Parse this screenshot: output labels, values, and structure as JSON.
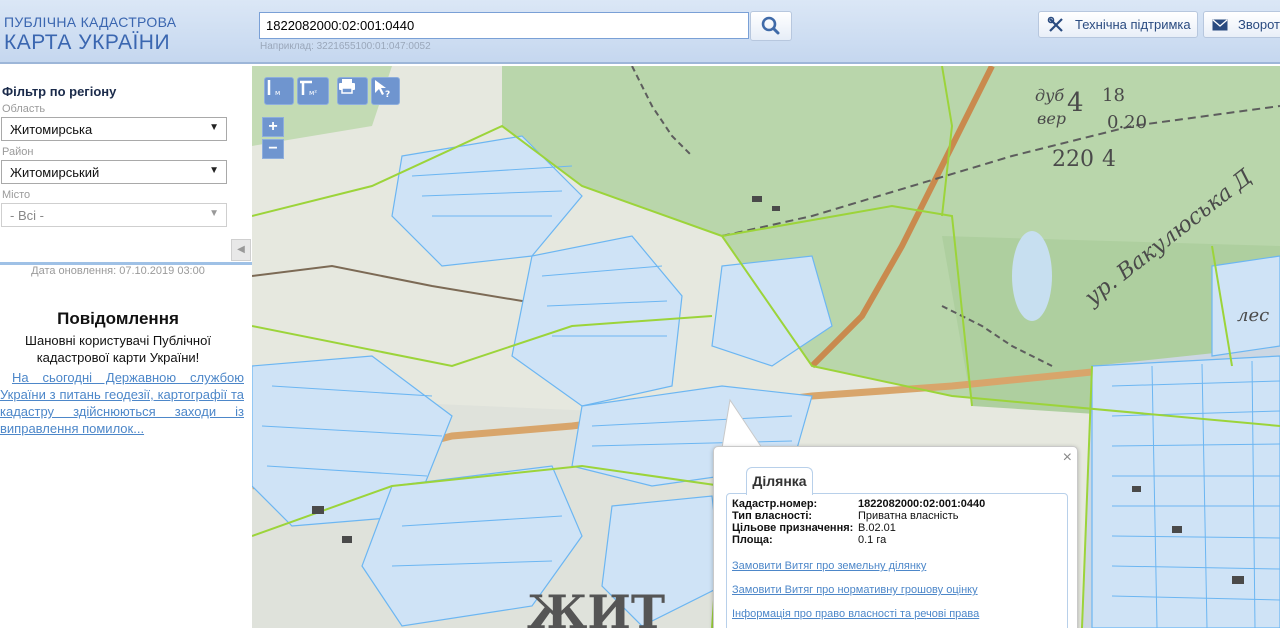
{
  "header": {
    "logo_line1": "ПУБЛІЧНА КАДАСТРОВА",
    "logo_line2": "КАРТА УКРАЇНИ",
    "search_value": "1822082000:02:001:0440",
    "search_hint": "Наприклад: 3221655100:01:047:0052",
    "support_label": "Технічна підтримка",
    "feedback_label": "Зворот"
  },
  "sidebar": {
    "filter_title": "Фільтр по регіону",
    "oblast_label": "Область",
    "oblast_value": "Житомирська",
    "raion_label": "Район",
    "raion_value": "Житомирський",
    "misto_label": "Місто",
    "misto_value": "- Всі -",
    "update_text": "Дата оновлення: 07.10.2019 03:00",
    "message_title": "Повідомлення",
    "message_body": "Шановні користувачі Публічної кадастрової карти України!",
    "message_link": "На сьогодні Державною службою України з питань геодезії, картографії та кадастру здійснюються заходи із виправлення помилок..."
  },
  "map": {
    "zoom_in": "+",
    "zoom_out": "−",
    "labels": {
      "a": "дуб",
      "b": "4",
      "c": "18",
      "d": "0.20",
      "e": "вер",
      "f": "220",
      "g": "4",
      "h": "ур. Вакулюська Д",
      "i": "лес",
      "j": "ЖИТ"
    }
  },
  "popup": {
    "tab_label": "Ділянка",
    "close_label": "×",
    "fields": [
      {
        "key": "Кадастр.номер:",
        "value": "1822082000:02:001:0440"
      },
      {
        "key": "Тип власності:",
        "value": "Приватна власність"
      },
      {
        "key": "Цільове призначення:",
        "value": "В.02.01"
      },
      {
        "key": "Площа:",
        "value": "0.1 га"
      }
    ],
    "links": [
      "Замовити Витяг про земельну ділянку",
      "Замовити Витяг про нормативну грошову оцінку",
      "Інформація про право власності та речові права"
    ]
  },
  "colors": {
    "parcel_blue": "#6cb6f2",
    "boundary_green": "#9cd43a",
    "forest_green": "#b9d6ab",
    "header_blue": "#3a66b0",
    "link_blue": "#4d87c9"
  },
  "icons": {
    "search": "magnifier-icon",
    "support": "tools-icon",
    "feedback": "envelope-icon"
  }
}
